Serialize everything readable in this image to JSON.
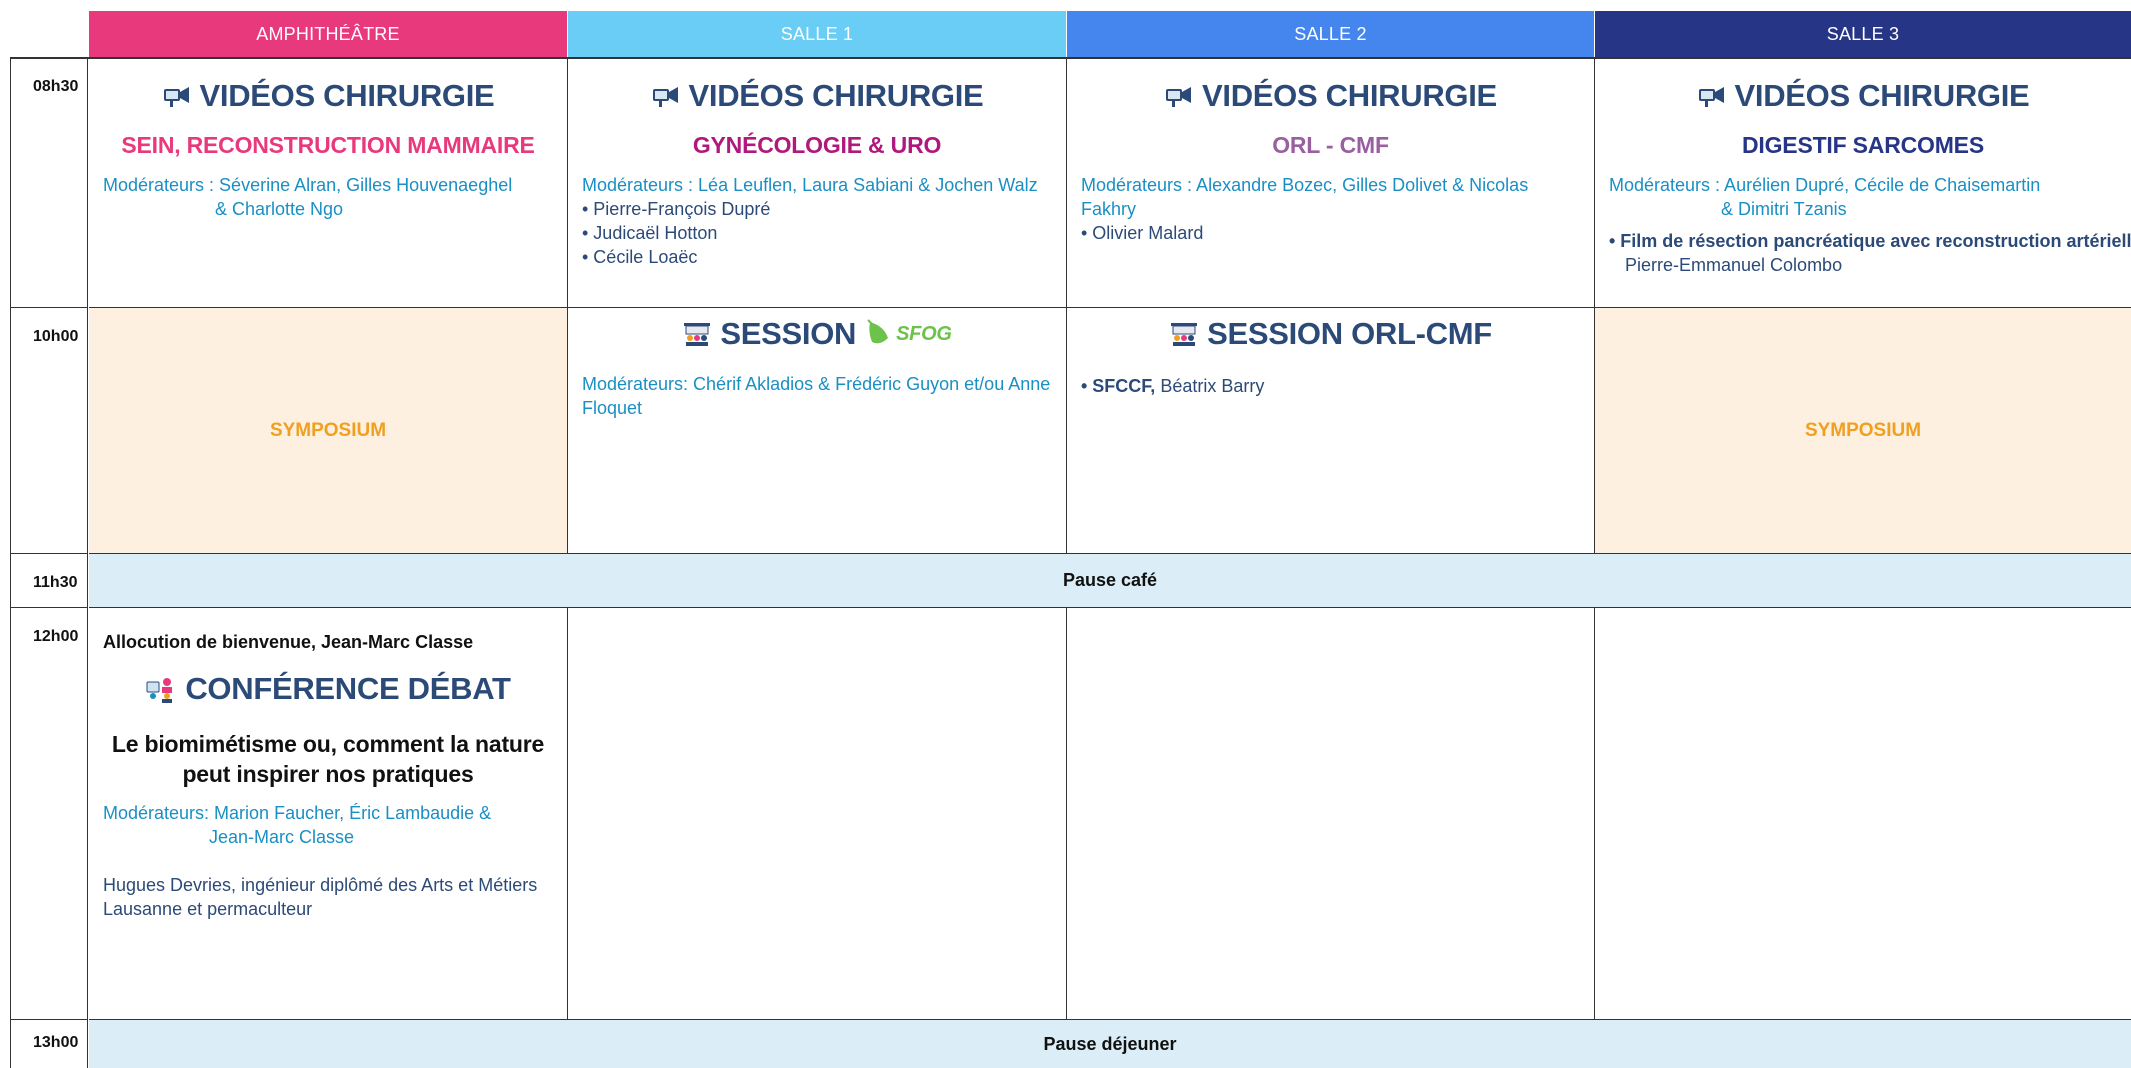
{
  "headers": [
    {
      "label": "AMPHITHÉÂTRE",
      "color": "#e8397d"
    },
    {
      "label": "SALLE 1",
      "color": "#69cdf6"
    },
    {
      "label": "SALLE 2",
      "color": "#4485ee"
    },
    {
      "label": "SALLE 3",
      "color": "#263586"
    }
  ],
  "times": {
    "t1": "08h30",
    "t2": "10h00",
    "t3": "11h30",
    "t4": "12h00",
    "t5": "13h00"
  },
  "row1": {
    "amphi": {
      "title": "VIDÉOS CHIRURGIE",
      "subtitle": "SEIN, RECONSTRUCTION MAMMAIRE",
      "subtitle_color": "#e8397d",
      "mod_line1": "Modérateurs : Séverine Alran, Gilles Houvenaeghel",
      "mod_line2": "& Charlotte Ngo"
    },
    "salle1": {
      "title": "VIDÉOS CHIRURGIE",
      "subtitle": "GYNÉCOLOGIE & URO",
      "subtitle_color": "#b0187b",
      "mod_line1": "Modérateurs : Léa Leuflen, Laura Sabiani & Jochen Walz",
      "items": [
        "• Pierre-François Dupré",
        "• Judicaël Hotton",
        "• Cécile Loaëc"
      ]
    },
    "salle2": {
      "title": "VIDÉOS CHIRURGIE",
      "subtitle": "ORL - CMF",
      "subtitle_color": "#9a5fa0",
      "mod_line1": "Modérateurs : Alexandre Bozec, Gilles Dolivet & Nicolas Fakhry",
      "items": [
        "• Olivier Malard"
      ]
    },
    "salle3": {
      "title": "VIDÉOS CHIRURGIE",
      "subtitle": "DIGESTIF SARCOMES",
      "subtitle_color": "#263586",
      "mod_line1": "Modérateurs : Aurélien Dupré, Cécile de Chaisemartin",
      "mod_line2": "& Dimitri Tzanis",
      "item_bold": "• Film de résection pancréatique avec reconstruction artérielle,",
      "item_rest": "Pierre-Emmanuel Colombo"
    }
  },
  "row2": {
    "amphi": {
      "label": "SYMPOSIUM"
    },
    "salle1": {
      "title": "SESSION",
      "logo_text": "SFOG",
      "mod": "Modérateurs: Chérif Akladios & Frédéric Guyon et/ou Anne Floquet"
    },
    "salle2": {
      "title": "SESSION ORL-CMF",
      "item_bold": "• SFCCF,",
      "item_rest": " Béatrix Barry"
    },
    "salle3": {
      "label": "SYMPOSIUM"
    },
    "symposium_bg": "#fdf0e0"
  },
  "pause_cafe": "Pause café",
  "row4": {
    "amphi": {
      "welcome": "Allocution de bienvenue, Jean-Marc Classe",
      "title": "CONFÉRENCE DÉBAT",
      "subtitle_line1": "Le biomimétisme ou, comment la nature",
      "subtitle_line2": "peut inspirer nos pratiques",
      "mod_line1": "Modérateurs: Marion Faucher, Éric Lambaudie &",
      "mod_line2": "Jean-Marc Classe",
      "speaker": "Hugues Devries, ingénieur diplômé des Arts et Métiers Lausanne et permaculteur"
    }
  },
  "pause_dejeuner": "Pause déjeuner",
  "icons": {
    "video": "video-camera-icon",
    "session": "session-audience-icon",
    "conference": "conference-debate-icon",
    "sfog": "sfog-logo"
  }
}
